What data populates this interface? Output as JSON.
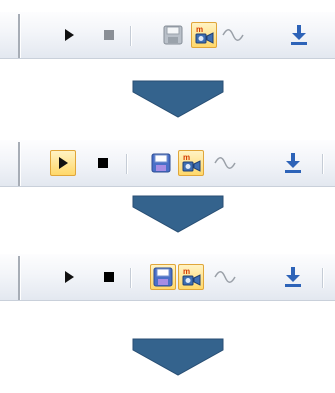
{
  "colors": {
    "arrow_fill": "#34638d",
    "arrow_stroke": "#284e73",
    "active_bg": "#ffd86a",
    "active_border": "#e0a63a"
  },
  "toolbars": [
    {
      "active": []
    },
    {
      "active": [
        "play-button"
      ]
    },
    {
      "active": [
        "save-button",
        "record-button"
      ]
    }
  ],
  "icons": [
    "play-icon",
    "stop-icon",
    "save-icon",
    "record-icon",
    "waveform-icon",
    "download-icon"
  ]
}
